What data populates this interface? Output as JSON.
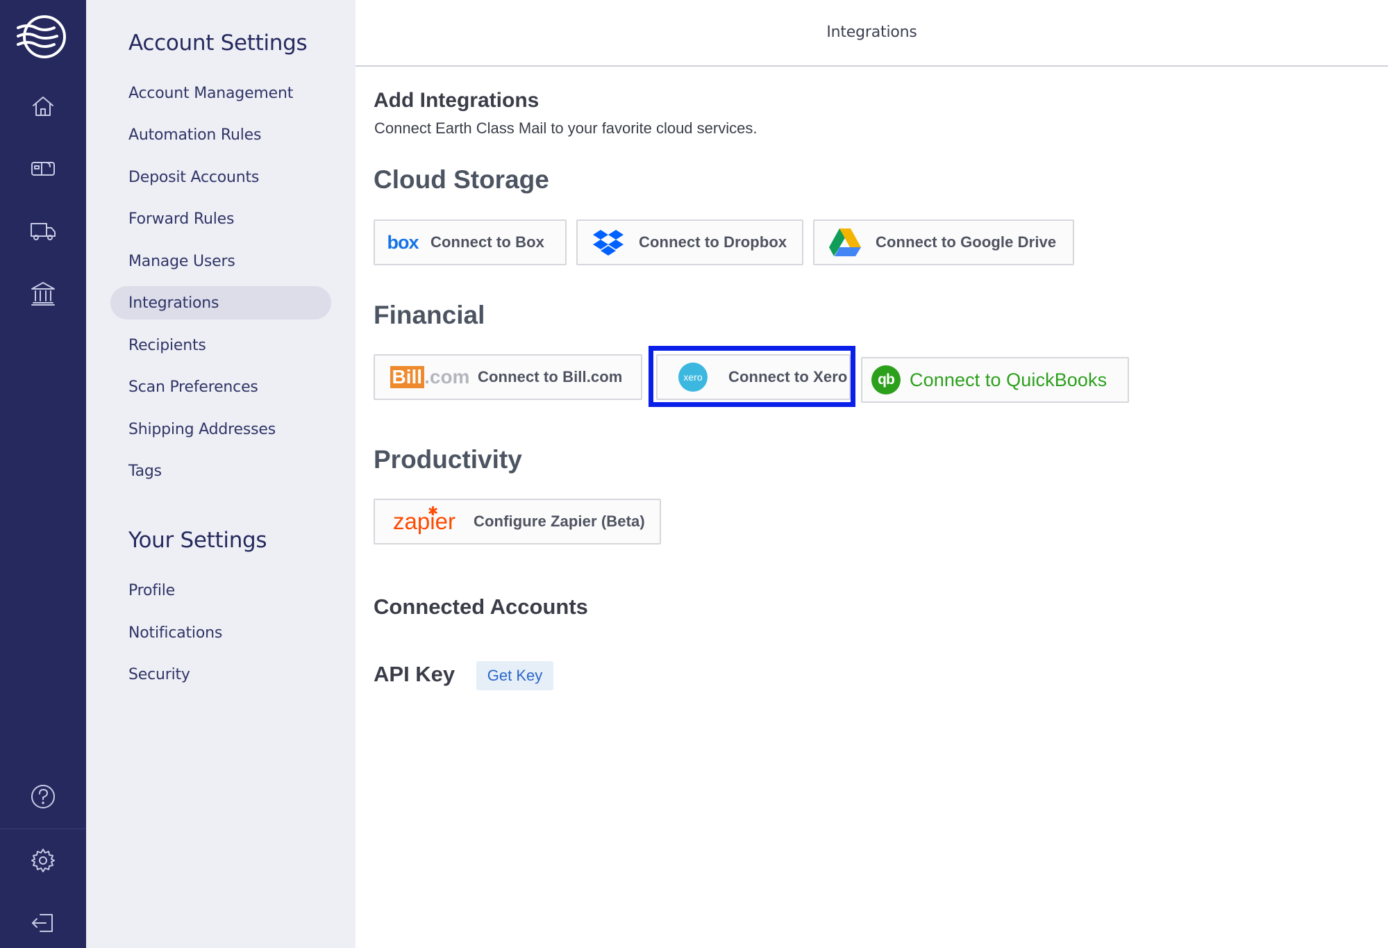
{
  "rail": {
    "icons": [
      "logo-icon",
      "home-icon",
      "mailbox-icon",
      "truck-icon",
      "bank-icon",
      "help-icon",
      "gear-icon",
      "logout-icon"
    ]
  },
  "sidebar": {
    "account_title": "Account Settings",
    "account_items": [
      {
        "label": "Account Management"
      },
      {
        "label": "Automation Rules"
      },
      {
        "label": "Deposit Accounts"
      },
      {
        "label": "Forward Rules"
      },
      {
        "label": "Manage Users"
      },
      {
        "label": "Integrations",
        "active": true
      },
      {
        "label": "Recipients"
      },
      {
        "label": "Scan Preferences"
      },
      {
        "label": "Shipping Addresses"
      },
      {
        "label": "Tags"
      }
    ],
    "your_title": "Your Settings",
    "your_items": [
      {
        "label": "Profile"
      },
      {
        "label": "Notifications"
      },
      {
        "label": "Security"
      }
    ]
  },
  "header": {
    "title": "Integrations"
  },
  "main": {
    "add_title": "Add Integrations",
    "add_subtitle": "Connect Earth Class Mail to your favorite cloud services.",
    "cloud_title": "Cloud Storage",
    "cloud_buttons": {
      "box": "Connect to Box",
      "dropbox": "Connect to Dropbox",
      "gdrive": "Connect to Google Drive"
    },
    "logo_text": {
      "box": "box",
      "bill_1": "Bill",
      "bill_2": ".com",
      "xero": "xero",
      "qb": "qb",
      "zapier": "zapier"
    },
    "financial_title": "Financial",
    "financial_buttons": {
      "bill": "Connect to Bill.com",
      "xero": "Connect to Xero",
      "quickbooks": "Connect to QuickBooks"
    },
    "productivity_title": "Productivity",
    "productivity_buttons": {
      "zapier": "Configure Zapier (Beta)"
    },
    "connected_title": "Connected Accounts",
    "api_title": "API Key",
    "get_key": "Get Key"
  },
  "colors": {
    "rail_bg": "#25295e",
    "sidebar_bg": "#eeeff5",
    "highlight": "#0a1fe8",
    "quickbooks_green": "#2ca01c",
    "link_blue": "#2a67c9"
  }
}
